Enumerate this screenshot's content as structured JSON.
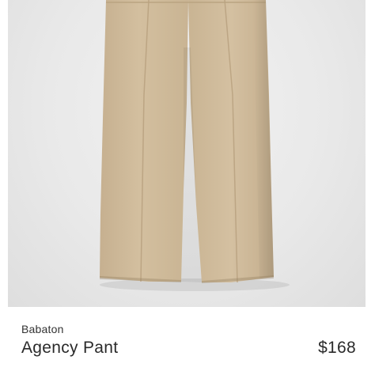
{
  "product": {
    "brand": "Babaton",
    "name": "Agency Pant",
    "price": "$168"
  },
  "colors": {
    "background": "#ffffff",
    "image_backdrop": "#e9e9e9",
    "pant_fabric": "#cdb898",
    "text": "#2a2a2a"
  },
  "icons": {
    "product_image": "product-photo"
  }
}
